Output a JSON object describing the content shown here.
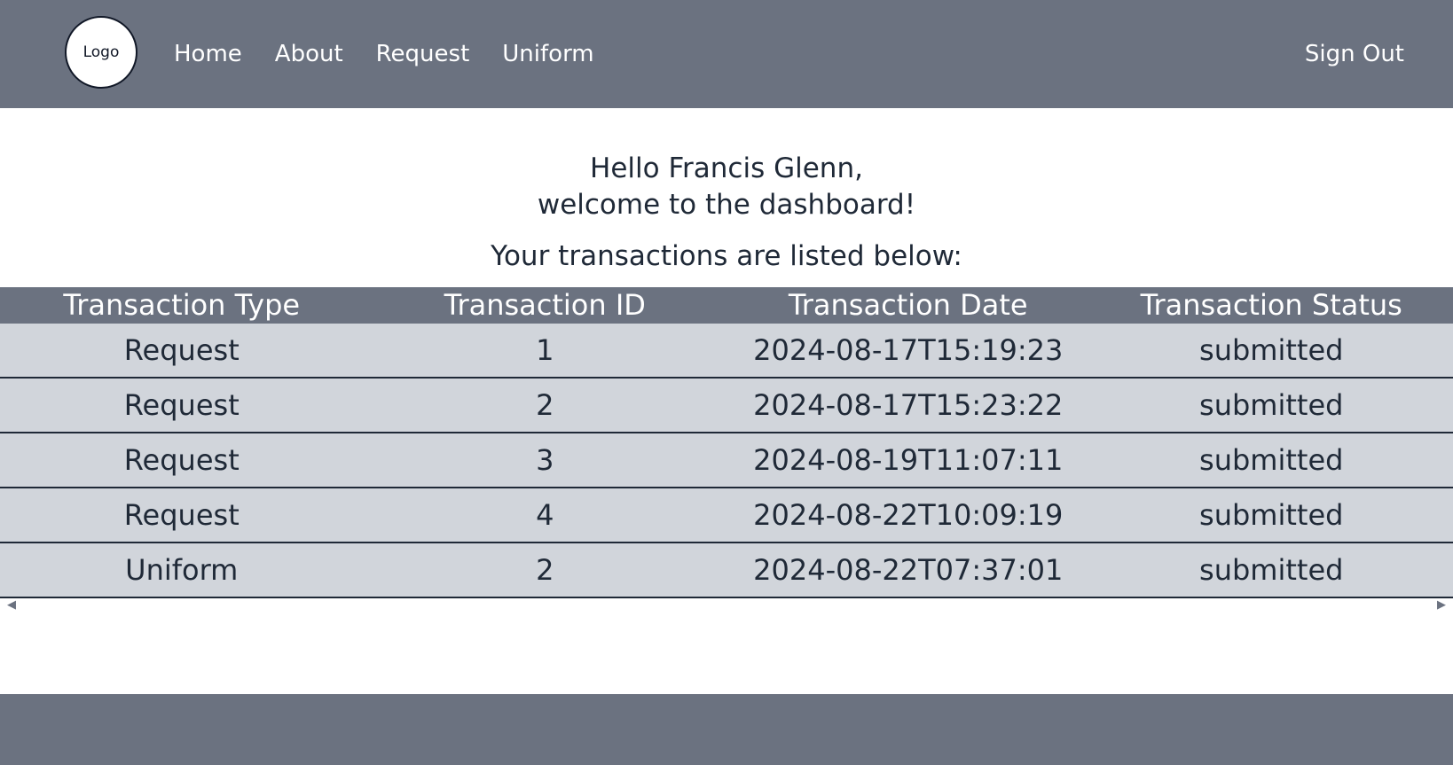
{
  "header": {
    "logo_text": "Logo",
    "nav": [
      {
        "label": "Home"
      },
      {
        "label": "About"
      },
      {
        "label": "Request"
      },
      {
        "label": "Uniform"
      }
    ],
    "signout_label": "Sign Out"
  },
  "main": {
    "greeting_line1": "Hello Francis Glenn,",
    "greeting_line2": "welcome to the dashboard!",
    "subheading": "Your transactions are listed below:"
  },
  "table": {
    "columns": [
      "Transaction Type",
      "Transaction ID",
      "Transaction Date",
      "Transaction Status"
    ],
    "rows": [
      [
        "Request",
        "1",
        "2024-08-17T15:19:23",
        "submitted"
      ],
      [
        "Request",
        "2",
        "2024-08-17T15:23:22",
        "submitted"
      ],
      [
        "Request",
        "3",
        "2024-08-19T11:07:11",
        "submitted"
      ],
      [
        "Request",
        "4",
        "2024-08-22T10:09:19",
        "submitted"
      ],
      [
        "Uniform",
        "2",
        "2024-08-22T07:37:01",
        "submitted"
      ]
    ]
  },
  "colors": {
    "navbar_bg": "#6b7280",
    "row_bg": "#d1d5db",
    "text": "#1f2937"
  },
  "icons": {
    "scroll_left": "scroll-left-arrow-icon",
    "scroll_right": "scroll-right-arrow-icon"
  }
}
